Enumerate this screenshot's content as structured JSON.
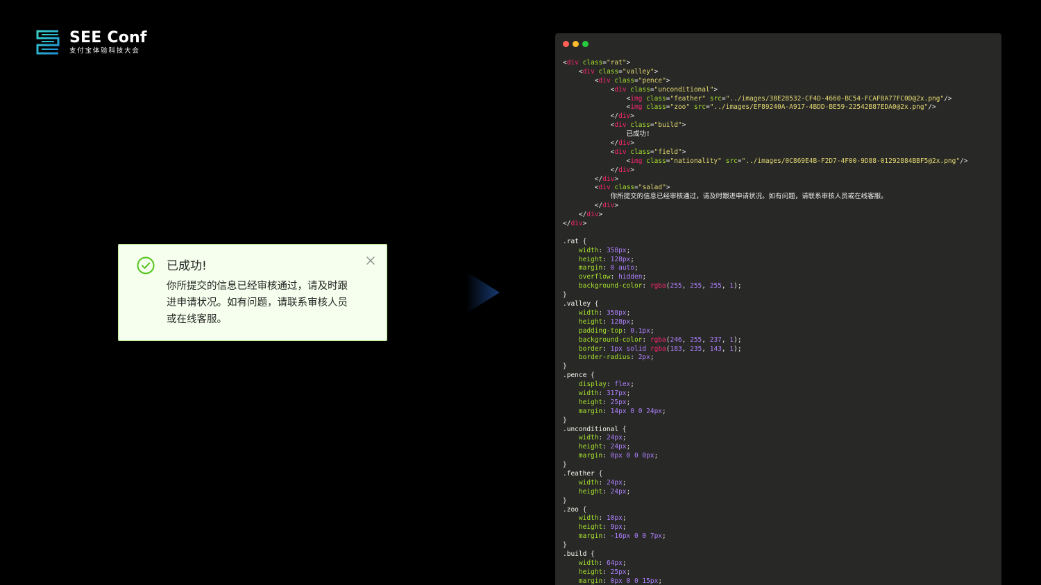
{
  "logo": {
    "title": "SEE Conf",
    "subtitle": "支付宝体验科技大会"
  },
  "alert": {
    "title": "已成功!",
    "description": "你所提交的信息已经审核通过，请及时跟进申请状况。如有问题，请联系审核人员或在线客服。",
    "icon": "check-circle-icon",
    "close_icon": "close-icon",
    "colors": {
      "background": "#f6ffed",
      "border": "#b7eb8f",
      "success": "#52c41a"
    }
  },
  "code_panel": {
    "window_dots": [
      "#ff5f56",
      "#ffbd2e",
      "#27c93f"
    ],
    "html_lines": [
      {
        "indent": 0,
        "type": "open",
        "tag": "div",
        "cls": "rat"
      },
      {
        "indent": 1,
        "type": "open",
        "tag": "div",
        "cls": "valley"
      },
      {
        "indent": 2,
        "type": "open",
        "tag": "div",
        "cls": "pence"
      },
      {
        "indent": 3,
        "type": "open",
        "tag": "div",
        "cls": "unconditional"
      },
      {
        "indent": 4,
        "type": "img",
        "tag": "img",
        "cls": "feather",
        "src": "../images/38E28532-CF4D-4660-BC54-FCAF8A77FC0D@2x.png"
      },
      {
        "indent": 4,
        "type": "img",
        "tag": "img",
        "cls": "zoo",
        "src": "../images/EF89240A-A917-4BDD-BE59-22542B87EDA0@2x.png"
      },
      {
        "indent": 3,
        "type": "close",
        "tag": "div"
      },
      {
        "indent": 3,
        "type": "open",
        "tag": "div",
        "cls": "build"
      },
      {
        "indent": 4,
        "type": "text",
        "text": "已成功!"
      },
      {
        "indent": 3,
        "type": "close",
        "tag": "div"
      },
      {
        "indent": 3,
        "type": "open",
        "tag": "div",
        "cls": "field"
      },
      {
        "indent": 4,
        "type": "img",
        "tag": "img",
        "cls": "nationality",
        "src": "../images/0C869E4B-F2D7-4F00-9D88-01292884BBF5@2x.png"
      },
      {
        "indent": 3,
        "type": "close",
        "tag": "div"
      },
      {
        "indent": 2,
        "type": "close",
        "tag": "div"
      },
      {
        "indent": 2,
        "type": "open",
        "tag": "div",
        "cls": "salad"
      },
      {
        "indent": 3,
        "type": "text",
        "text": "你所提交的信息已经审核通过，请及时跟进申请状况。如有问题，请联系审核人员或在线客服。"
      },
      {
        "indent": 2,
        "type": "close",
        "tag": "div"
      },
      {
        "indent": 1,
        "type": "close",
        "tag": "div"
      },
      {
        "indent": 0,
        "type": "close",
        "tag": "div"
      }
    ],
    "css_rules": [
      {
        "selector": ".rat",
        "props": [
          [
            "width",
            "358px"
          ],
          [
            "height",
            "128px"
          ],
          [
            "margin",
            "0 auto"
          ],
          [
            "overflow",
            "hidden"
          ],
          [
            "background-color",
            "rgba(255, 255, 255, 1)"
          ]
        ]
      },
      {
        "selector": ".valley",
        "props": [
          [
            "width",
            "358px"
          ],
          [
            "height",
            "128px"
          ],
          [
            "padding-top",
            "0.1px"
          ],
          [
            "background-color",
            "rgba(246, 255, 237, 1)"
          ],
          [
            "border",
            "1px solid rgba(183, 235, 143, 1)"
          ],
          [
            "border-radius",
            "2px"
          ]
        ]
      },
      {
        "selector": ".pence",
        "props": [
          [
            "display",
            "flex"
          ],
          [
            "width",
            "317px"
          ],
          [
            "height",
            "25px"
          ],
          [
            "margin",
            "14px 0 0 24px"
          ]
        ]
      },
      {
        "selector": ".unconditional",
        "props": [
          [
            "width",
            "24px"
          ],
          [
            "height",
            "24px"
          ],
          [
            "margin",
            "0px 0 0 0px"
          ]
        ]
      },
      {
        "selector": ".feather",
        "props": [
          [
            "width",
            "24px"
          ],
          [
            "height",
            "24px"
          ]
        ]
      },
      {
        "selector": ".zoo",
        "props": [
          [
            "width",
            "10px"
          ],
          [
            "height",
            "9px"
          ],
          [
            "margin",
            "-16px 0 0 7px"
          ]
        ]
      },
      {
        "selector": ".build",
        "props": [
          [
            "width",
            "64px"
          ],
          [
            "height",
            "25px"
          ],
          [
            "margin",
            "0px 0 0 15px"
          ]
        ]
      }
    ]
  }
}
